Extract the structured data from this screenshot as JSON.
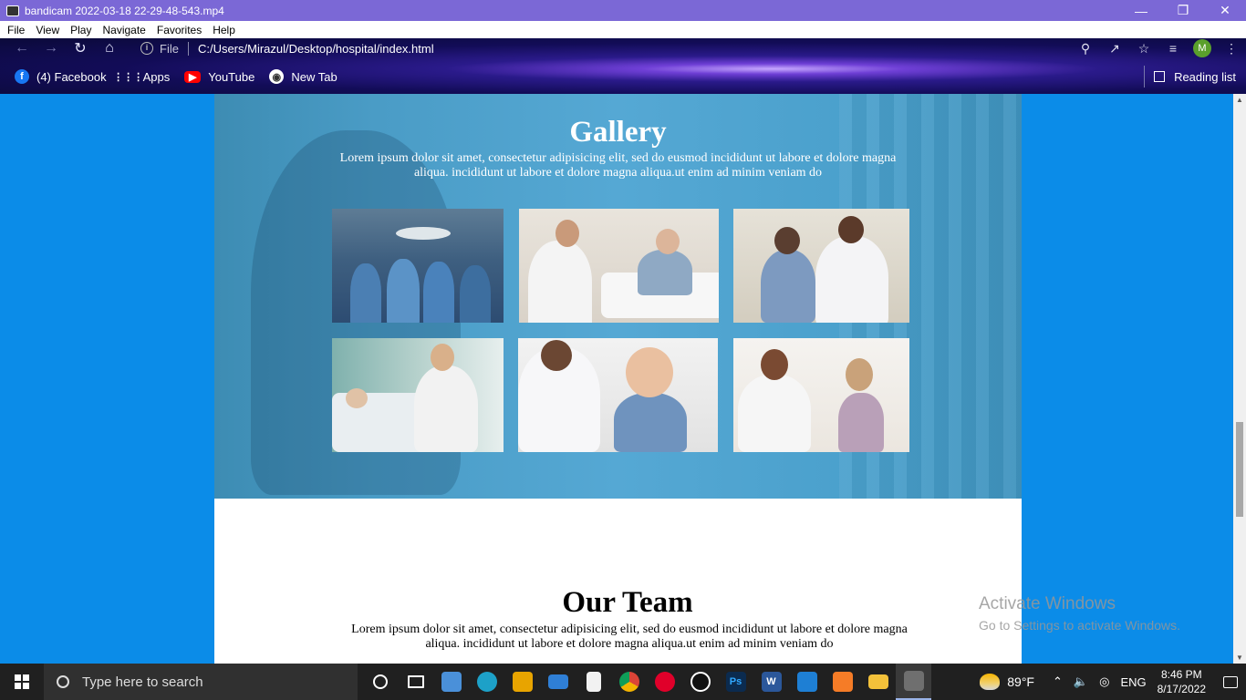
{
  "player": {
    "title": "bandicam 2022-03-18 22-29-48-543.mp4",
    "menus": [
      "File",
      "View",
      "Play",
      "Navigate",
      "Favorites",
      "Help"
    ]
  },
  "browser": {
    "file_label": "File",
    "url": "C:/Users/Mirazul/Desktop/hospital/index.html",
    "profile_initial": "M",
    "bookmarks": [
      "(4) Facebook",
      "Apps",
      "YouTube",
      "New Tab"
    ],
    "reading_list": "Reading list"
  },
  "page": {
    "gallery_title": "Gallery",
    "gallery_text": "Lorem ipsum dolor sit amet, consectetur adipisicing elit, sed do eusmod incididunt ut labore et dolore magna aliqua. incididunt ut labore et dolore magna aliqua.ut enim ad minim veniam do",
    "team_title": "Our Team",
    "team_text": "Lorem ipsum dolor sit amet, consectetur adipisicing elit, sed do eusmod incididunt ut labore et dolore magna aliqua. incididunt ut labore et dolore magna aliqua.ut enim ad minim veniam do"
  },
  "watermark": {
    "line1": "Activate Windows",
    "line2": "Go to Settings to activate Windows."
  },
  "taskbar": {
    "search_placeholder": "Type here to search",
    "temperature": "89°F",
    "language": "ENG",
    "time": "8:46 PM",
    "date": "8/17/2022"
  }
}
